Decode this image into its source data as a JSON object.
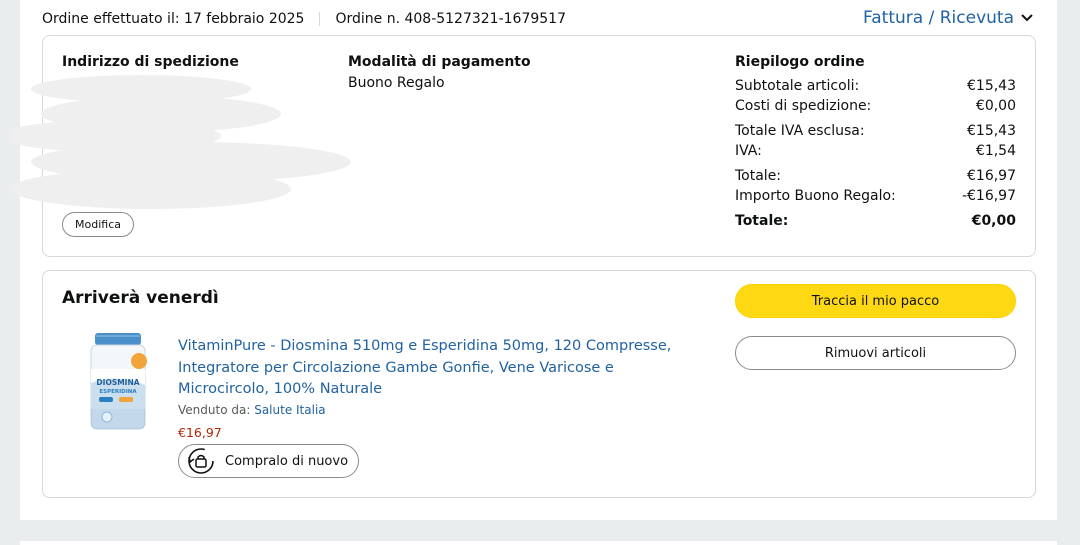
{
  "order": {
    "placed_label": "Ordine effettuato il: 17 febbraio 2025",
    "number_label": "Ordine n. 408-5127321-1679517",
    "invoice_link": "Fattura / Ricevuta"
  },
  "shipping": {
    "title": "Indirizzo di spedizione",
    "edit_button": "Modifica"
  },
  "payment": {
    "title": "Modalità di pagamento",
    "method": "Buono Regalo"
  },
  "summary": {
    "title": "Riepilogo ordine",
    "rows": [
      {
        "label": "Subtotale articoli:",
        "value": "€15,43"
      },
      {
        "label": "Costi di spedizione:",
        "value": "€0,00"
      },
      {
        "label": "Totale IVA esclusa:",
        "value": "€15,43"
      },
      {
        "label": "IVA:",
        "value": "€1,54"
      },
      {
        "label": "Totale:",
        "value": "€16,97"
      },
      {
        "label": "Importo Buono Regalo:",
        "value": "-€16,97"
      },
      {
        "label": "Totale:",
        "value": "€0,00"
      }
    ]
  },
  "shipment": {
    "arrival": "Arriverà venerdì",
    "track_button": "Traccia il mio pacco",
    "remove_button": "Rimuovi articoli",
    "product": {
      "title": "VitaminPure - Diosmina 510mg e Esperidina 50mg, 120 Compresse, Integratore per Circolazione Gambe Gonfie, Vene Varicose e Microcircolo, 100% Naturale",
      "sold_by_label": "Venduto da:",
      "seller": "Salute Italia",
      "price": "€16,97",
      "buy_again": "Compralo di nuovo",
      "image_label_line1": "DIOSMINA",
      "image_label_line2": "ESPERIDINA"
    }
  },
  "colors": {
    "link": "#2162a1",
    "price": "#b12704",
    "track_button": "#ffd814",
    "border": "#d5d9d9"
  }
}
